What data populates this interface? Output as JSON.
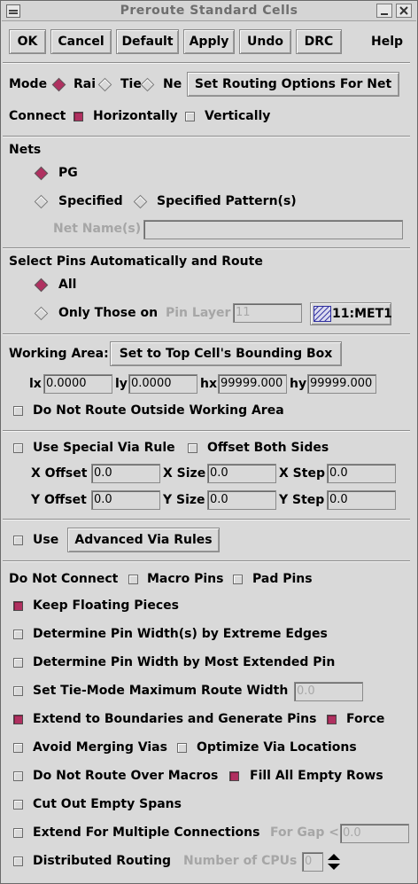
{
  "window": {
    "title": "Preroute Standard Cells"
  },
  "toolbar": {
    "ok": "OK",
    "cancel": "Cancel",
    "default": "Default",
    "apply": "Apply",
    "undo": "Undo",
    "drc": "DRC",
    "help": "Help"
  },
  "mode": {
    "label": "Mode",
    "options": [
      "Rai",
      "Tie",
      "Ne"
    ],
    "selected": "Rai",
    "set_routing_button": "Set Routing Options For Net"
  },
  "connect": {
    "label": "Connect",
    "horizontally": "Horizontally",
    "horizontally_checked": true,
    "vertically": "Vertically",
    "vertically_checked": false
  },
  "nets": {
    "label": "Nets",
    "pg": "PG",
    "specified": "Specified",
    "specified_pattern": "Specified Pattern(s)",
    "selected": "PG",
    "net_names_label": "Net Name(s)",
    "net_names_value": ""
  },
  "select_pins": {
    "label": "Select Pins Automatically and Route",
    "all": "All",
    "only_those_on": "Only Those on",
    "selected": "All",
    "pin_layer_label": "Pin Layer",
    "pin_layer_value": "11",
    "layer_button": "11:MET1"
  },
  "working_area": {
    "label": "Working Area:",
    "bbox_button": "Set to Top Cell's Bounding Box",
    "lx_label": "lx",
    "lx": "0.0000",
    "ly_label": "ly",
    "ly": "0.0000",
    "hx_label": "hx",
    "hx": "99999.000",
    "hy_label": "hy",
    "hy": "99999.000",
    "no_route_outside": "Do Not Route Outside Working Area",
    "no_route_outside_checked": false
  },
  "via": {
    "use_special": "Use Special Via Rule",
    "use_special_checked": false,
    "offset_both": "Offset Both Sides",
    "offset_both_checked": false,
    "x_offset_label": "X Offset",
    "x_offset": "0.0",
    "x_size_label": "X Size",
    "x_size": "0.0",
    "x_step_label": "X Step",
    "x_step": "0.0",
    "y_offset_label": "Y Offset",
    "y_offset": "0.0",
    "y_size_label": "Y Size",
    "y_size": "0.0",
    "y_step_label": "Y Step",
    "y_step": "0.0"
  },
  "advanced": {
    "use_label": "Use",
    "use_checked": false,
    "button": "Advanced Via Rules"
  },
  "options": {
    "do_not_connect": "Do Not Connect",
    "macro_pins": "Macro Pins",
    "macro_pins_checked": false,
    "pad_pins": "Pad Pins",
    "pad_pins_checked": false,
    "keep_floating": "Keep Floating Pieces",
    "keep_floating_checked": true,
    "pin_width_extreme": "Determine Pin Width(s) by Extreme Edges",
    "pin_width_extreme_checked": false,
    "pin_width_extended": "Determine Pin Width by Most Extended Pin",
    "pin_width_extended_checked": false,
    "tie_mode_width": "Set Tie-Mode Maximum Route Width",
    "tie_mode_width_checked": false,
    "tie_mode_width_value": "0.0",
    "extend_boundaries": "Extend to Boundaries and Generate Pins",
    "extend_boundaries_checked": true,
    "force": "Force",
    "force_checked": true,
    "avoid_merging": "Avoid Merging Vias",
    "avoid_merging_checked": false,
    "optimize_via": "Optimize Via Locations",
    "optimize_via_checked": false,
    "no_route_macros": "Do Not Route Over Macros",
    "no_route_macros_checked": false,
    "fill_empty_rows": "Fill All Empty Rows",
    "fill_empty_rows_checked": true,
    "cut_out_spans": "Cut Out Empty Spans",
    "cut_out_spans_checked": false,
    "extend_multiple": "Extend For Multiple Connections",
    "extend_multiple_checked": false,
    "for_gap_label": "For Gap <",
    "for_gap_value": "0.0",
    "distributed": "Distributed Routing",
    "distributed_checked": false,
    "num_cpus_label": "Number of CPUs",
    "num_cpus_value": "0"
  },
  "colors": {
    "background": "#d9d9d9",
    "check_on": "#b03060",
    "title_text": "#6e6e6e"
  }
}
